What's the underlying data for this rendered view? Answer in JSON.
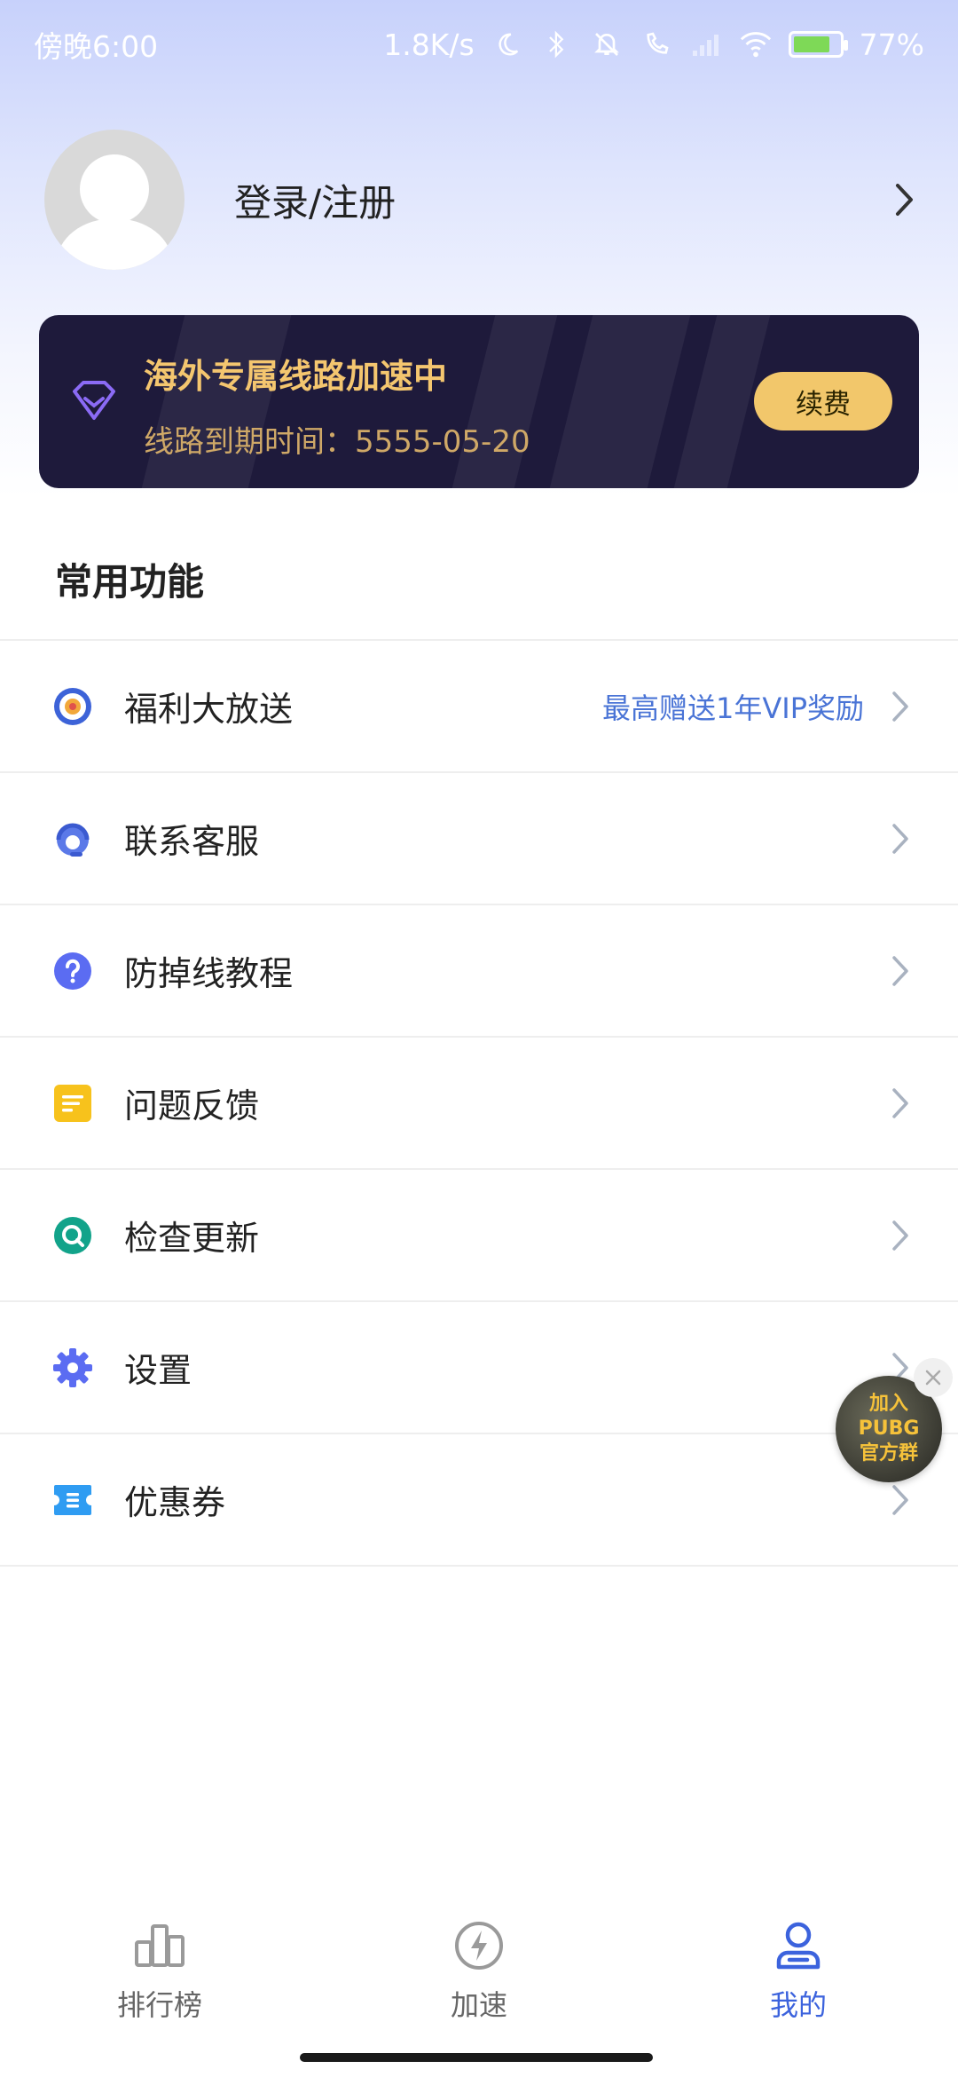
{
  "status_bar": {
    "time": "傍晚6:00",
    "net_speed": "1.8K/s",
    "battery": "77%",
    "battery_level_percent": 77
  },
  "profile": {
    "login_label": "登录/注册"
  },
  "vip_card": {
    "title": "海外专属线路加速中",
    "expire_text": "线路到期时间：5555-05-20",
    "renew_label": "续费",
    "colors": {
      "bg": "#1e1a3b",
      "title": "#f4c66f",
      "button": "#f2c76b"
    }
  },
  "section": {
    "title": "常用功能"
  },
  "menu": {
    "items": [
      {
        "label": "福利大放送",
        "note": "最高赠送1年VIP奖励",
        "icon": "gift-badge-icon"
      },
      {
        "label": "联系客服",
        "icon": "customer-service-icon"
      },
      {
        "label": "防掉线教程",
        "icon": "question-icon"
      },
      {
        "label": "问题反馈",
        "icon": "feedback-icon"
      },
      {
        "label": "检查更新",
        "icon": "update-search-icon"
      },
      {
        "label": "设置",
        "icon": "gear-icon"
      },
      {
        "label": "优惠券",
        "icon": "coupon-icon"
      }
    ]
  },
  "float_badge": {
    "line1": "加入",
    "line2": "PUBG",
    "line3": "官方群"
  },
  "bottom_nav": {
    "items": [
      {
        "label": "排行榜",
        "icon": "ranking-icon"
      },
      {
        "label": "加速",
        "icon": "boost-icon"
      },
      {
        "label": "我的",
        "icon": "user-icon",
        "active": true
      }
    ],
    "active_color": "#3c63dd"
  }
}
